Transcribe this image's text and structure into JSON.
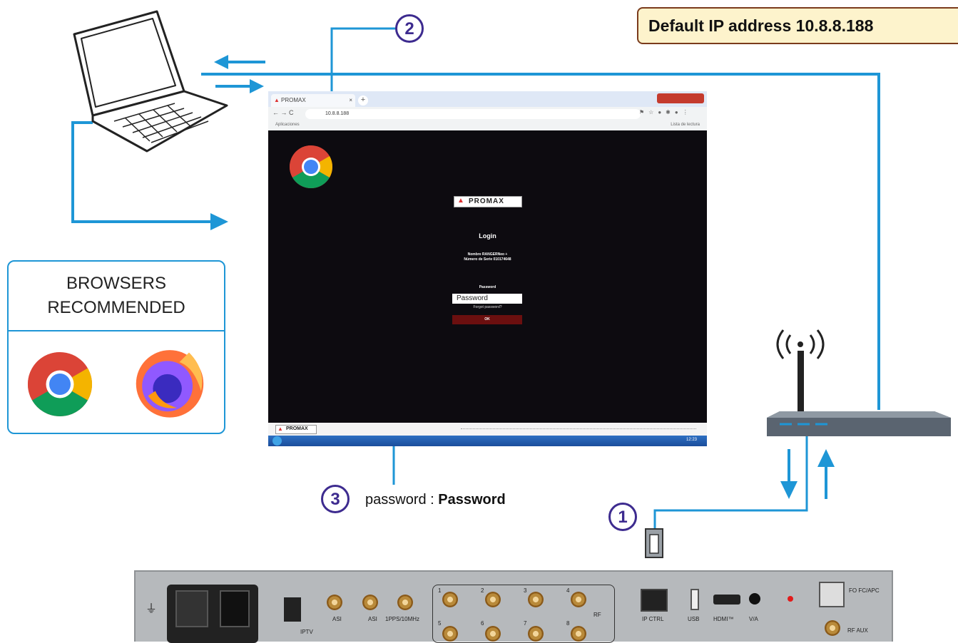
{
  "ip_note": "Default IP address 10.8.8.188",
  "steps": {
    "one": "1",
    "two": "2",
    "three": "3"
  },
  "password_note": {
    "prefix": "password : ",
    "value": "Password"
  },
  "browsers_box": {
    "line1": "BROWSERS",
    "line2": "RECOMMENDED",
    "browsers": [
      "chrome-icon",
      "firefox-icon"
    ]
  },
  "browser_window": {
    "tab_label": "PROMAX",
    "url": "10.8.8.188",
    "bookmarks_label": "Aplicaciones",
    "reading_list": "Lista de lectura",
    "logo": "PROMAX",
    "login_title": "Login",
    "device_line1": "Nombre RANGERNeo +",
    "device_line2": "Número de Serie 010174648",
    "password_label": "Password",
    "password_placeholder": "Password",
    "forgot": "Forgot password?",
    "ok": "OK",
    "footer_logo": "PROMAX",
    "clock": "12:23"
  },
  "panel_labels": {
    "iptv": "IPTV",
    "asi1": "ASI",
    "asi2": "ASI",
    "pps": "1PPS/10MHz",
    "rf": "RF",
    "ports": [
      "1",
      "2",
      "3",
      "4",
      "5",
      "6",
      "7",
      "8"
    ],
    "ip_ctrl": "IP CTRL",
    "usb": "USB",
    "hdmi": "HDMI™",
    "va": "V/A",
    "fo": "FO FC/APC",
    "rf_aux": "RF AUX"
  },
  "colors": {
    "link": "#1e96d6",
    "step": "#3d2b8f",
    "ip_border": "#7a3b1c",
    "ip_fill": "#fdf3cc"
  }
}
